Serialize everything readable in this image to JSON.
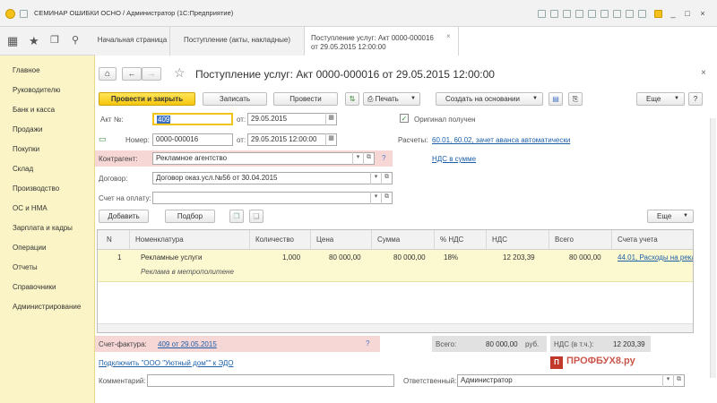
{
  "window": {
    "title": "СЕМИНАР ОШИБКИ ОСНО / Администратор (1С:Предприятие)",
    "controls": [
      "_",
      "□",
      "×"
    ]
  },
  "tabs": [
    {
      "label": "Начальная страница"
    },
    {
      "label": "Поступление (акты, накладные)"
    },
    {
      "label_line1": "Поступление услуг: Акт 0000-000016",
      "label_line2": "от 29.05.2015 12:00:00",
      "close": "×"
    }
  ],
  "sidebar": {
    "items": [
      "Главное",
      "Руководителю",
      "Банк и касса",
      "Продажи",
      "Покупки",
      "Склад",
      "Производство",
      "ОС и НМА",
      "Зарплата и кадры",
      "Операции",
      "Отчеты",
      "Справочники",
      "Администрирование"
    ]
  },
  "form": {
    "title": "Поступление услуг: Акт 0000-000016 от 29.05.2015 12:00:00",
    "close": "×",
    "toolbar": {
      "post_close": "Провести и закрыть",
      "save": "Записать",
      "post": "Провести",
      "print": "Печать",
      "create_based": "Создать на основании",
      "more": "Еще",
      "help": "?"
    },
    "fields": {
      "act_label": "Акт №:",
      "act_value": "409",
      "from_label1": "от:",
      "date1": "29.05.2015",
      "number_label": "Номер:",
      "number_value": "0000-000016",
      "from_label2": "от:",
      "date2": "29.05.2015 12:00:00",
      "original_label": "Оригинал получен",
      "settlements_label": "Расчеты:",
      "settlements_link": "60.01, 60.02, зачет аванса автоматически",
      "vat_link": "НДС в сумме",
      "counterparty_label": "Контрагент:",
      "counterparty_value": "Рекламное агентство",
      "contract_label": "Договор:",
      "contract_value": "Договор оказ.усл.№56 от 30.04.2015",
      "invoice_label": "Счет на оплату:",
      "invoice_value": "",
      "q": "?"
    },
    "table_toolbar": {
      "add": "Добавить",
      "pick": "Подбор",
      "more": "Еще"
    },
    "table": {
      "headers": [
        "N",
        "Номенклатура",
        "Количество",
        "Цена",
        "Сумма",
        "% НДС",
        "НДС",
        "Всего",
        "Счета учета"
      ],
      "rows": [
        {
          "n": "1",
          "item": "Рекламные услуги",
          "comment": "Реклама в метрополитене",
          "qty": "1,000",
          "price": "80 000,00",
          "sum": "80 000,00",
          "vat_rate": "18%",
          "vat": "12 203,39",
          "total": "80 000,00",
          "accounts": "44.01, Расходы на рекл"
        }
      ]
    },
    "footer": {
      "invoice_label": "Счет-фактура:",
      "invoice_link": "409 от 29.05.2015",
      "q": "?",
      "total_label": "Всего:",
      "total_value": "80 000,00",
      "currency": "руб.",
      "vat_label": "НДС (в т.ч.):",
      "vat_value": "12 203,39",
      "edo_link": "Подключить \"ООО \"Уютный дом\"\" к ЭДО",
      "comment_label": "Комментарий:",
      "comment_value": "",
      "responsible_label": "Ответственный:",
      "responsible_value": "Администратор"
    }
  },
  "watermark": {
    "text": "ПРОФБУХ8.ру"
  }
}
